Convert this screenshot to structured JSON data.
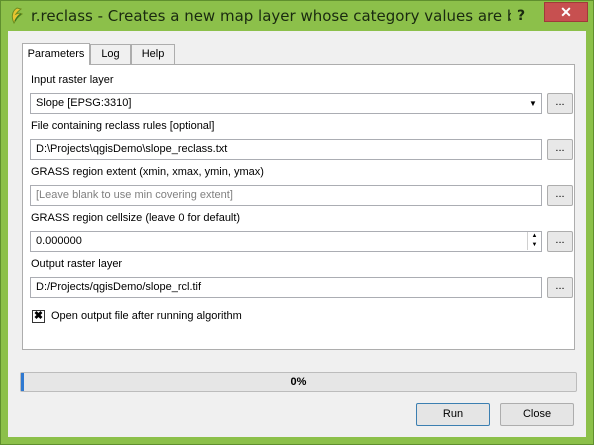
{
  "window": {
    "title": "r.reclass - Creates a new map layer whose category values are based up...",
    "help_glyph": "?",
    "close_glyph": "✕"
  },
  "tabs": [
    {
      "label": "Parameters",
      "active": true
    },
    {
      "label": "Log",
      "active": false
    },
    {
      "label": "Help",
      "active": false
    }
  ],
  "params": {
    "input_label": "Input raster layer",
    "input_value": "Slope [EPSG:3310]",
    "rules_label": "File containing reclass rules [optional]",
    "rules_value": "D:\\Projects\\qgisDemo\\slope_reclass.txt",
    "region_label": "GRASS region extent (xmin, xmax, ymin, ymax)",
    "region_placeholder": "[Leave blank to use min covering extent]",
    "cellsize_label": "GRASS region cellsize (leave 0 for default)",
    "cellsize_value": "0.000000",
    "output_label": "Output raster layer",
    "output_value": "D:/Projects/qgisDemo/slope_rcl.tif",
    "open_output_label": "Open output file after running algorithm",
    "open_output_checked": true,
    "browse_label": "..."
  },
  "progress": {
    "value": 0,
    "text": "0%"
  },
  "buttons": {
    "run": "Run",
    "close": "Close"
  },
  "colors": {
    "titlebar": "#8cc04a",
    "accent": "#2f79d1",
    "close": "#c75050"
  }
}
